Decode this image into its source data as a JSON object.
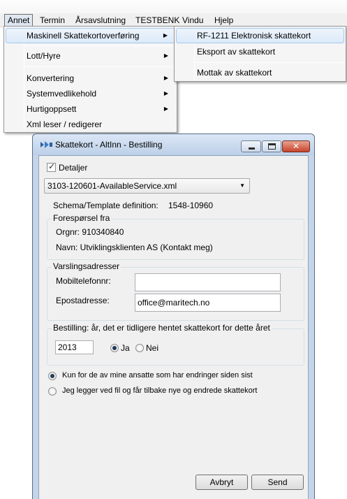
{
  "menubar": {
    "items": [
      "Annet",
      "Termin",
      "Årsavslutning",
      "TESTBENK",
      "Vindu",
      "Hjelp"
    ],
    "active": "Annet"
  },
  "menu_annet": {
    "items": [
      {
        "label": "Maskinell Skattekortoverføring",
        "submenu": true
      },
      {
        "label": "Lott/Hyre",
        "submenu": true
      },
      {
        "label": "Konvertering",
        "submenu": true
      },
      {
        "label": "Systemvedlikehold",
        "submenu": true
      },
      {
        "label": "Hurtigoppsett",
        "submenu": true
      },
      {
        "label": "Xml leser / redigerer",
        "submenu": false
      }
    ]
  },
  "submenu": {
    "items": [
      "RF-1211 Elektronisk skattekort",
      "Eksport av skattekort",
      "Mottak av skattekort"
    ]
  },
  "window": {
    "title": "Skattekort - AltInn - Bestilling",
    "close_glyph": "✕"
  },
  "form": {
    "details_label": "Detaljer",
    "details_checked": true,
    "file_select": "3103-120601-AvailableService.xml",
    "schema_label": "Schema/Template definition:",
    "schema_value": "1548-10960",
    "request_group": {
      "title": "Forespørsel fra",
      "orgnr": "Orgnr: 910340840",
      "name": "Navn: Utviklingsklienten AS (Kontakt meg)"
    },
    "notify_group": {
      "title": "Varslingsadresser",
      "mobile_label": "Mobiltelefonnr:",
      "mobile_value": "",
      "email_label": "Epostadresse:",
      "email_value": "office@maritech.no"
    },
    "order_group": {
      "title": "Bestilling: år, det er tidligere hentet skattekort for dette året",
      "year": "2013",
      "yes_label": "Ja",
      "no_label": "Nei",
      "selected": "Ja"
    },
    "option1_label": "Kun for de av mine ansatte som har endringer siden sist",
    "option2_label": "Jeg legger ved fil og får tilbake nye og endrede skattekort",
    "option_selected": 1,
    "cancel_label": "Avbryt",
    "send_label": "Send"
  },
  "colors": {
    "window_frame": "#c4d5ea",
    "client_bg": "#f0f0f0",
    "menu_highlight": "#dceaf9",
    "close_button": "#c8432b"
  }
}
